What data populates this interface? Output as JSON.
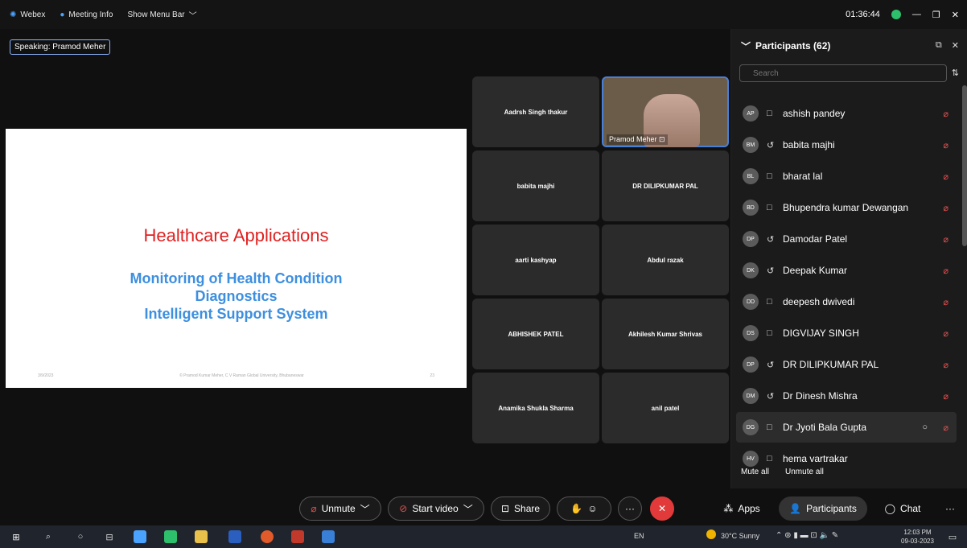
{
  "topbar": {
    "app": "Webex",
    "meeting_info": "Meeting Info",
    "show_menu": "Show Menu Bar",
    "time": "01:36:44"
  },
  "speaking": "Speaking: Pramod Meher",
  "slide": {
    "title": "Healthcare Applications",
    "lines": [
      "Monitoring of Health Condition",
      "Diagnostics",
      "Intelligent Support System"
    ],
    "footer_date": "3/9/2023",
    "footer_text": "© Pramod Kumar Meher, C V Raman Global University, Bhubaneswar",
    "footer_page": "23"
  },
  "tiles": [
    "Aadrsh Singh thakur",
    "Pramod Meher",
    "babita majhi",
    "DR DILIPKUMAR PAL",
    "aarti kashyap",
    "Abdul razak",
    "ABHISHEK PATEL",
    "Akhilesh Kumar Shrivas",
    "Anamika Shukla Sharma",
    "anil patel"
  ],
  "panel": {
    "title": "Participants (62)",
    "search_placeholder": "Search",
    "participants": [
      {
        "initials": "AP",
        "name": "ashish pandey"
      },
      {
        "initials": "BM",
        "name": "babita majhi"
      },
      {
        "initials": "BL",
        "name": "bharat lal"
      },
      {
        "initials": "BD",
        "name": "Bhupendra kumar Dewangan"
      },
      {
        "initials": "DP",
        "name": "Damodar Patel"
      },
      {
        "initials": "DK",
        "name": "Deepak Kumar"
      },
      {
        "initials": "DD",
        "name": "deepesh dwivedi"
      },
      {
        "initials": "DS",
        "name": "DIGVIJAY SINGH"
      },
      {
        "initials": "DP",
        "name": "DR DILIPKUMAR PAL"
      },
      {
        "initials": "DM",
        "name": "Dr Dinesh Mishra"
      },
      {
        "initials": "DG",
        "name": "Dr Jyoti Bala Gupta"
      },
      {
        "initials": "HV",
        "name": "hema vartrakar"
      }
    ],
    "mute_all": "Mute all",
    "unmute_all": "Unmute all"
  },
  "controls": {
    "unmute": "Unmute",
    "start_video": "Start video",
    "share": "Share",
    "apps": "Apps",
    "participants": "Participants",
    "chat": "Chat"
  },
  "taskbar": {
    "lang": "EN",
    "weather": "30°C Sunny",
    "time": "12:03 PM",
    "date": "09-03-2023"
  },
  "colors": {
    "red": "#e23a3a",
    "slide_title": "#e02020",
    "slide_sub": "#3d8fe0",
    "active_border": "#4a7fd6"
  }
}
